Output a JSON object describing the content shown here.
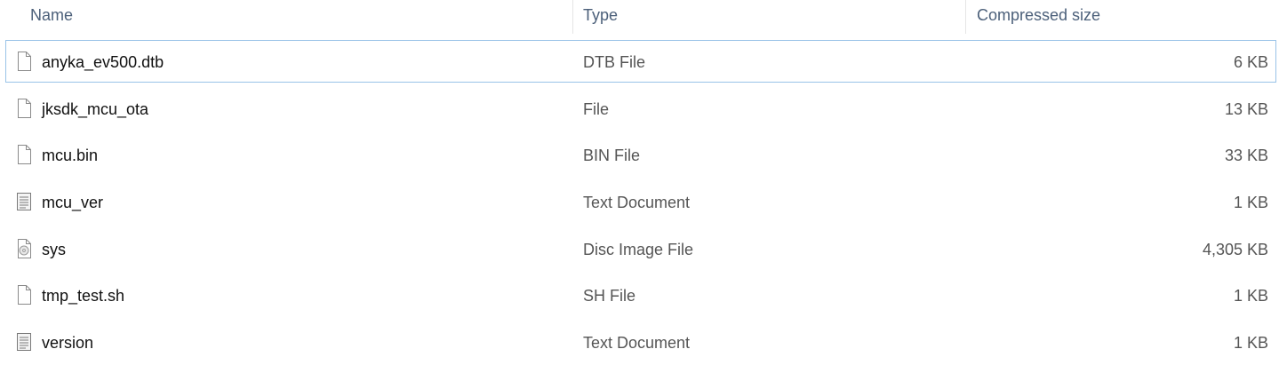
{
  "columns": {
    "name": "Name",
    "type": "Type",
    "compressed_size": "Compressed size"
  },
  "files": [
    {
      "name": "anyka_ev500.dtb",
      "type": "DTB File",
      "size": "6 KB",
      "icon": "blank-file-icon"
    },
    {
      "name": "jksdk_mcu_ota",
      "type": "File",
      "size": "13 KB",
      "icon": "blank-file-icon"
    },
    {
      "name": "mcu.bin",
      "type": "BIN File",
      "size": "33 KB",
      "icon": "blank-file-icon"
    },
    {
      "name": "mcu_ver",
      "type": "Text Document",
      "size": "1 KB",
      "icon": "text-document-icon"
    },
    {
      "name": "sys",
      "type": "Disc Image File",
      "size": "4,305 KB",
      "icon": "disc-image-icon"
    },
    {
      "name": "tmp_test.sh",
      "type": "SH File",
      "size": "1 KB",
      "icon": "blank-file-icon"
    },
    {
      "name": "version",
      "type": "Text Document",
      "size": "1 KB",
      "icon": "text-document-icon"
    }
  ],
  "colors": {
    "header_text": "#4c607a",
    "focus_border": "#99c3e8"
  }
}
